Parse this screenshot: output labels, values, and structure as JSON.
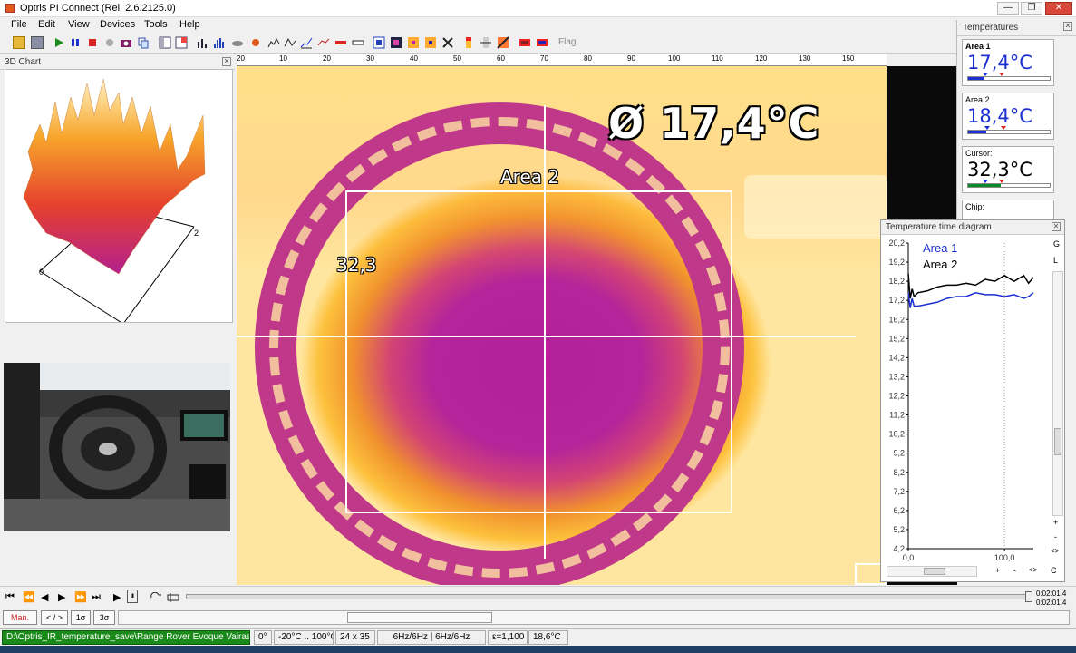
{
  "app": {
    "title": "Optris PI Connect (Rel. 2.6.2125.0)"
  },
  "window_controls": {
    "minimize": "—",
    "restore": "❐",
    "close": "✕"
  },
  "menu": [
    {
      "label": "File"
    },
    {
      "label": "Edit"
    },
    {
      "label": "View"
    },
    {
      "label": "Devices"
    },
    {
      "label": "Tools"
    },
    {
      "label": "Help"
    }
  ],
  "toolbar": {
    "flag_label": "Flag"
  },
  "chart3d_panel": {
    "title": "3D Chart",
    "axis_label_0": "0",
    "axis_label_2": "2"
  },
  "ruler": {
    "ticks": [
      "20",
      "10",
      "20",
      "30",
      "40",
      "50",
      "60",
      "70",
      "80",
      "90",
      "100",
      "110",
      "120",
      "130",
      "140",
      "150"
    ]
  },
  "thermal_view": {
    "average_label": "Ø   17,4°C",
    "area2_label": "Area 2",
    "cursor_value": "32,3"
  },
  "temperatures_panel": {
    "title": "Temperatures",
    "items": [
      {
        "name": "Area 1",
        "value": "17,4°C",
        "color": "#1c2fd1",
        "bar_color": "#1c2fd1",
        "level": 0.2
      },
      {
        "name": "Area 2",
        "value": "18,4°C",
        "color": "#1c2fd1",
        "bar_color": "#1c2fd1",
        "level": 0.22
      },
      {
        "name": "Cursor:",
        "value": "32,3°C",
        "color": "#000000",
        "bar_color": "#0a8a2a",
        "level": 0.4
      },
      {
        "name": "Chip:",
        "value": ""
      }
    ]
  },
  "time_diagram": {
    "title": "Temperature time diagram",
    "side_buttons": [
      "G",
      "L"
    ],
    "scroll_buttons": [
      "+",
      "-",
      "<>"
    ],
    "bottom_buttons": [
      "+",
      "-",
      "<>",
      "C"
    ],
    "chart_data": {
      "type": "line",
      "ylim": [
        4.2,
        20.2
      ],
      "y_ticks": [
        "20,2",
        "19,2",
        "18,2",
        "17,2",
        "16,2",
        "15,2",
        "14,2",
        "13,2",
        "12,2",
        "11,2",
        "10,2",
        "9,2",
        "8,2",
        "7,2",
        "6,2",
        "5,2",
        "4,2"
      ],
      "x_ticks": [
        "0,0",
        "100,0"
      ],
      "xlim": [
        0,
        130
      ],
      "series": [
        {
          "name": "Area 1",
          "color": "#1c2fd1",
          "x": [
            0,
            2,
            4,
            6,
            10,
            20,
            30,
            40,
            50,
            60,
            70,
            80,
            90,
            100,
            110,
            120,
            125,
            130
          ],
          "y": [
            17.6,
            16.8,
            17.3,
            16.9,
            16.9,
            17.0,
            17.1,
            17.3,
            17.4,
            17.4,
            17.6,
            17.5,
            17.5,
            17.4,
            17.5,
            17.3,
            17.4,
            17.6
          ]
        },
        {
          "name": "Area 2",
          "color": "#000000",
          "x": [
            0,
            2,
            4,
            6,
            10,
            20,
            30,
            40,
            50,
            60,
            70,
            80,
            90,
            100,
            110,
            120,
            125,
            130
          ],
          "y": [
            18.6,
            17.3,
            17.8,
            17.4,
            17.6,
            17.7,
            17.9,
            18.0,
            18.0,
            18.1,
            18.0,
            18.3,
            18.2,
            18.5,
            18.2,
            18.5,
            18.1,
            18.4
          ]
        }
      ]
    }
  },
  "transport": {
    "buttons": [
      "⏮",
      "⏪",
      "◀",
      "▶",
      "⏩",
      "⏭",
      "▶",
      "⏸"
    ],
    "time_top": "0:02:01.4",
    "time_bottom": "0:02:01.4"
  },
  "row2": {
    "buttons": [
      "Man.",
      "< / >",
      "1σ",
      "3σ"
    ]
  },
  "status": {
    "file": "D:\\Optris_IR_temperature_save\\Range Rover Evoque Vairas.ravi",
    "angle": "0°",
    "range": "-20°C .. 100°C",
    "resolution": "24 x 35",
    "framerate": "6Hz/6Hz | 6Hz/6Hz",
    "emissivity": "ε=1,100",
    "ambient": "18,6°C"
  }
}
